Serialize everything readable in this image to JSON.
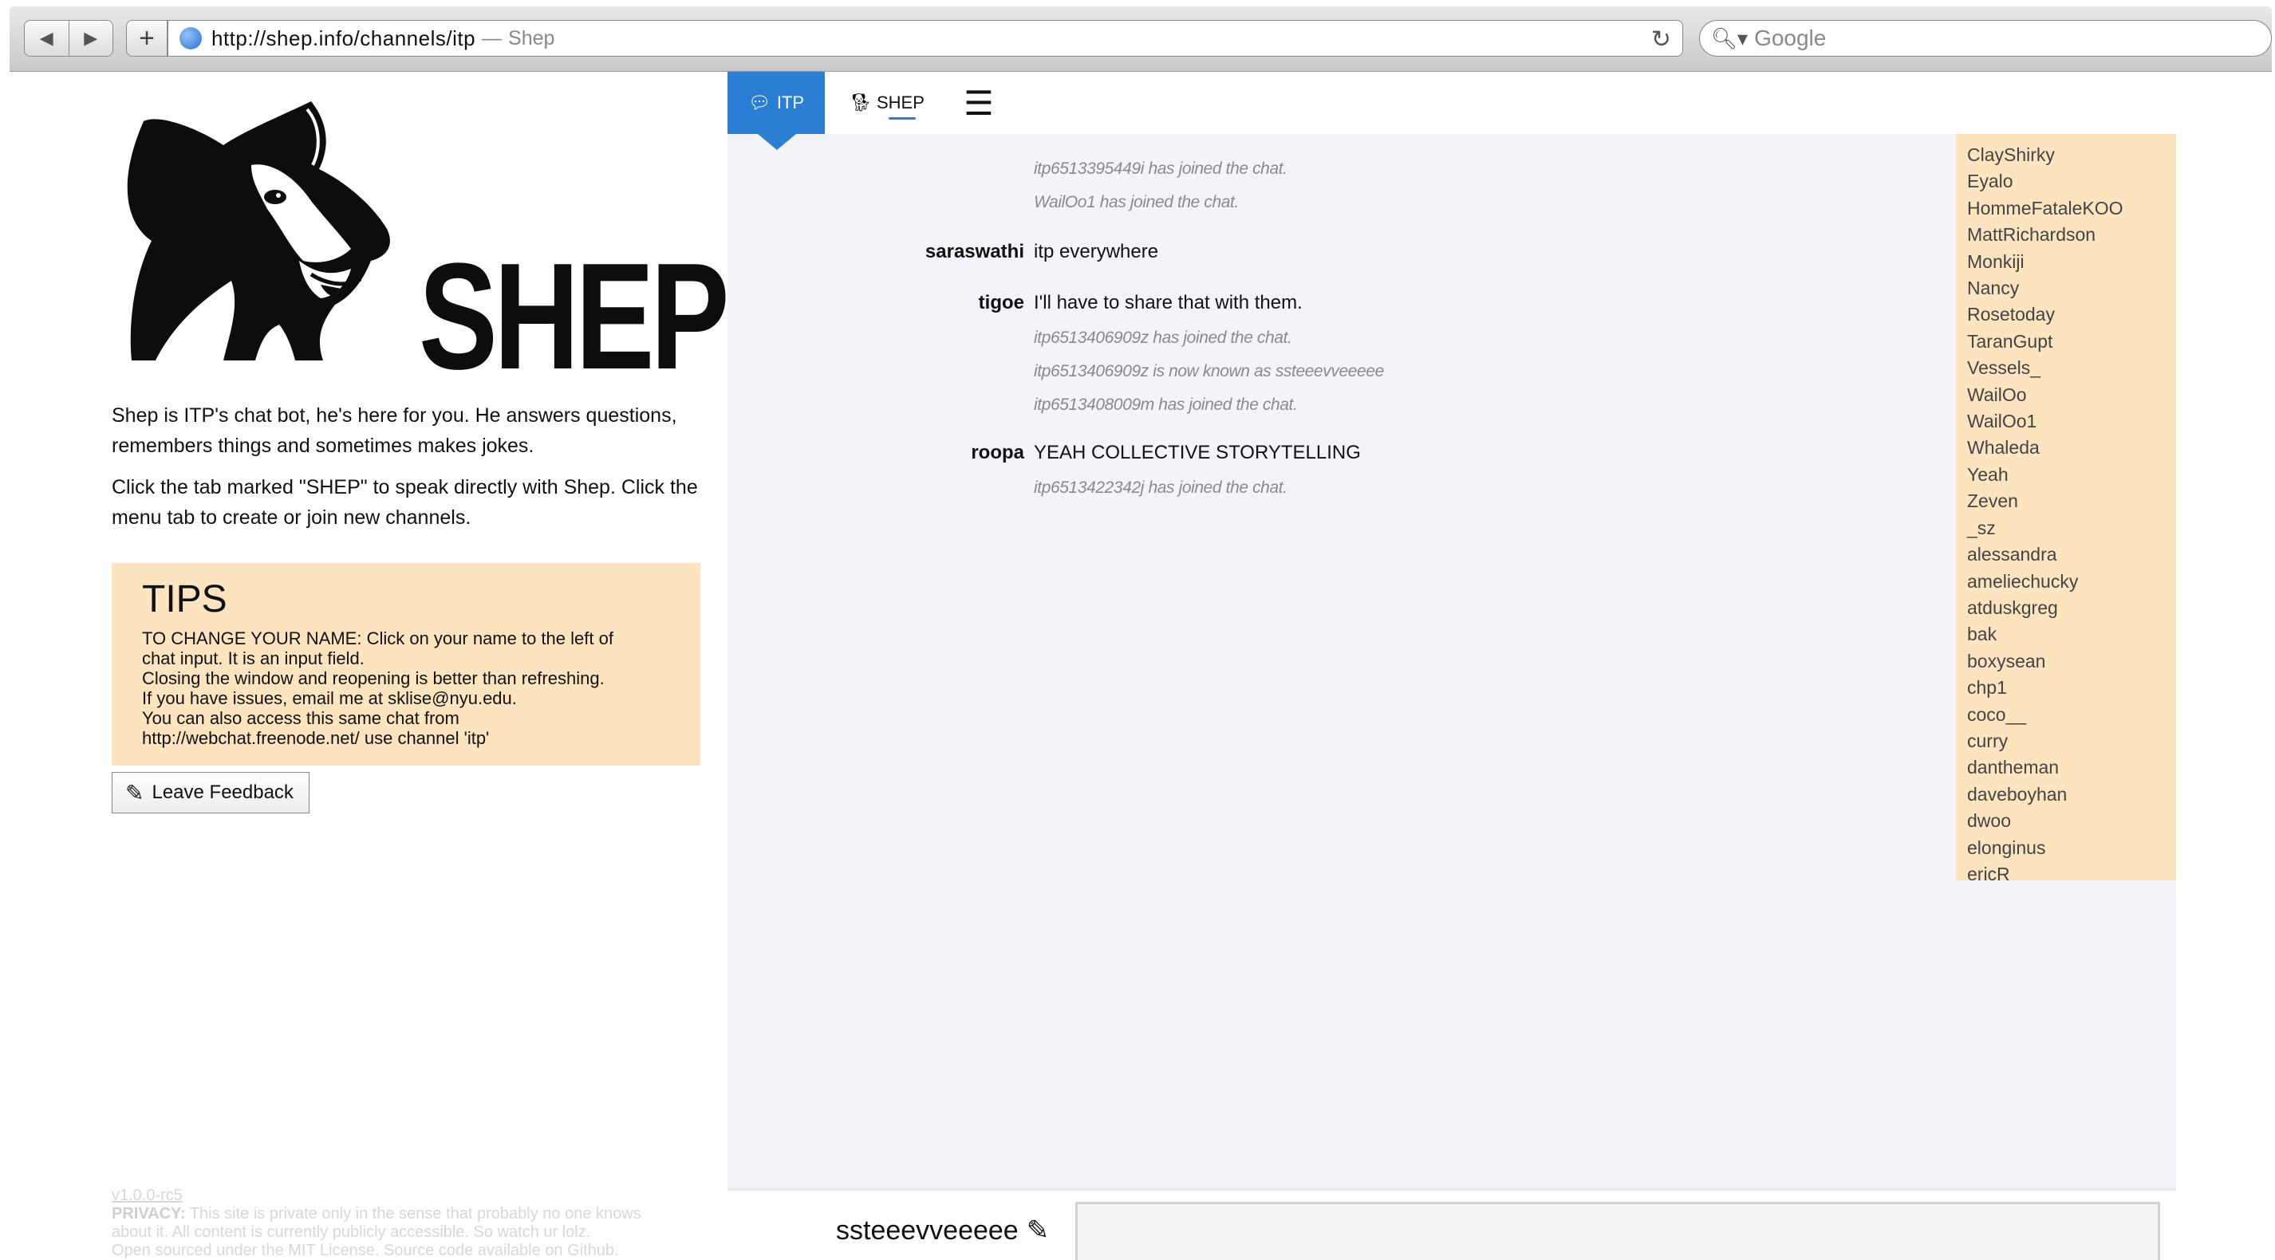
{
  "browser": {
    "url": "http://shep.info/channels/itp",
    "separator": "—",
    "page_title": "Shep",
    "search_placeholder": "Google"
  },
  "left": {
    "logo_word": "SHEP",
    "description": "Shep is ITP's chat bot, he's here for you. He answers questions, remembers things and sometimes makes jokes.",
    "instructions": "Click the tab marked \"SHEP\" to speak directly with Shep. Click the menu tab to create or join new channels.",
    "tips": {
      "title": "TIPS",
      "lines": [
        "TO CHANGE YOUR NAME: Click on your name to the left of",
        "chat input. It is an input field.",
        "Closing the window and reopening is better than refreshing.",
        "If you have issues, email me at sklise@nyu.edu.",
        "You can also access this same chat from",
        "http://webchat.freenode.net/ use channel 'itp'"
      ]
    },
    "feedback_label": "Leave Feedback",
    "footer": {
      "version": "v1.0.0-rc5",
      "privacy_label": "PRIVACY:",
      "privacy_text": "This site is private only in the sense that probably no one knows",
      "line2": "about it. All content is currently publicly accessible. So watch ur lolz.",
      "line3": "Open sourced under the MIT License. Source code available on Github."
    }
  },
  "tabs": {
    "itp": "ITP",
    "shep": "SHEP"
  },
  "messages": [
    {
      "type": "system",
      "text": "itp6513395449i has joined the chat."
    },
    {
      "type": "system",
      "text": "WailOo1 has joined the chat."
    },
    {
      "type": "message",
      "nick": "saraswathi",
      "text": "itp everywhere"
    },
    {
      "type": "message",
      "nick": "tigoe",
      "text": "I'll have to share that with them."
    },
    {
      "type": "system",
      "text": "itp6513406909z has joined the chat."
    },
    {
      "type": "system",
      "text": "itp6513406909z is now known as ssteeevveeeee"
    },
    {
      "type": "system",
      "text": "itp6513408009m has joined the chat."
    },
    {
      "type": "message",
      "nick": "roopa",
      "text": "YEAH COLLECTIVE STORYTELLING"
    },
    {
      "type": "system",
      "text": "itp6513422342j has joined the chat."
    }
  ],
  "users": [
    "ClayShirky",
    "Eyalo",
    "HommeFataleKOO",
    "MattRichardson",
    "Monkiji",
    "Nancy",
    "Rosetoday",
    "TaranGupt",
    "Vessels_",
    "WailOo",
    "WailOo1",
    "Whaleda",
    "Yeah",
    "Zeven",
    "_sz",
    "alessandra",
    "ameliechucky",
    "atduskgreg",
    "bak",
    "boxysean",
    "chp1",
    "coco__",
    "curry",
    "dantheman",
    "daveboyhan",
    "dwoo",
    "elonginus",
    "ericR"
  ],
  "input": {
    "nickname": "ssteeevveeeee",
    "value": ""
  },
  "colors": {
    "accent": "#2a7fd4",
    "tips_bg": "#fce4bf",
    "chat_bg": "#f2f4fa"
  }
}
